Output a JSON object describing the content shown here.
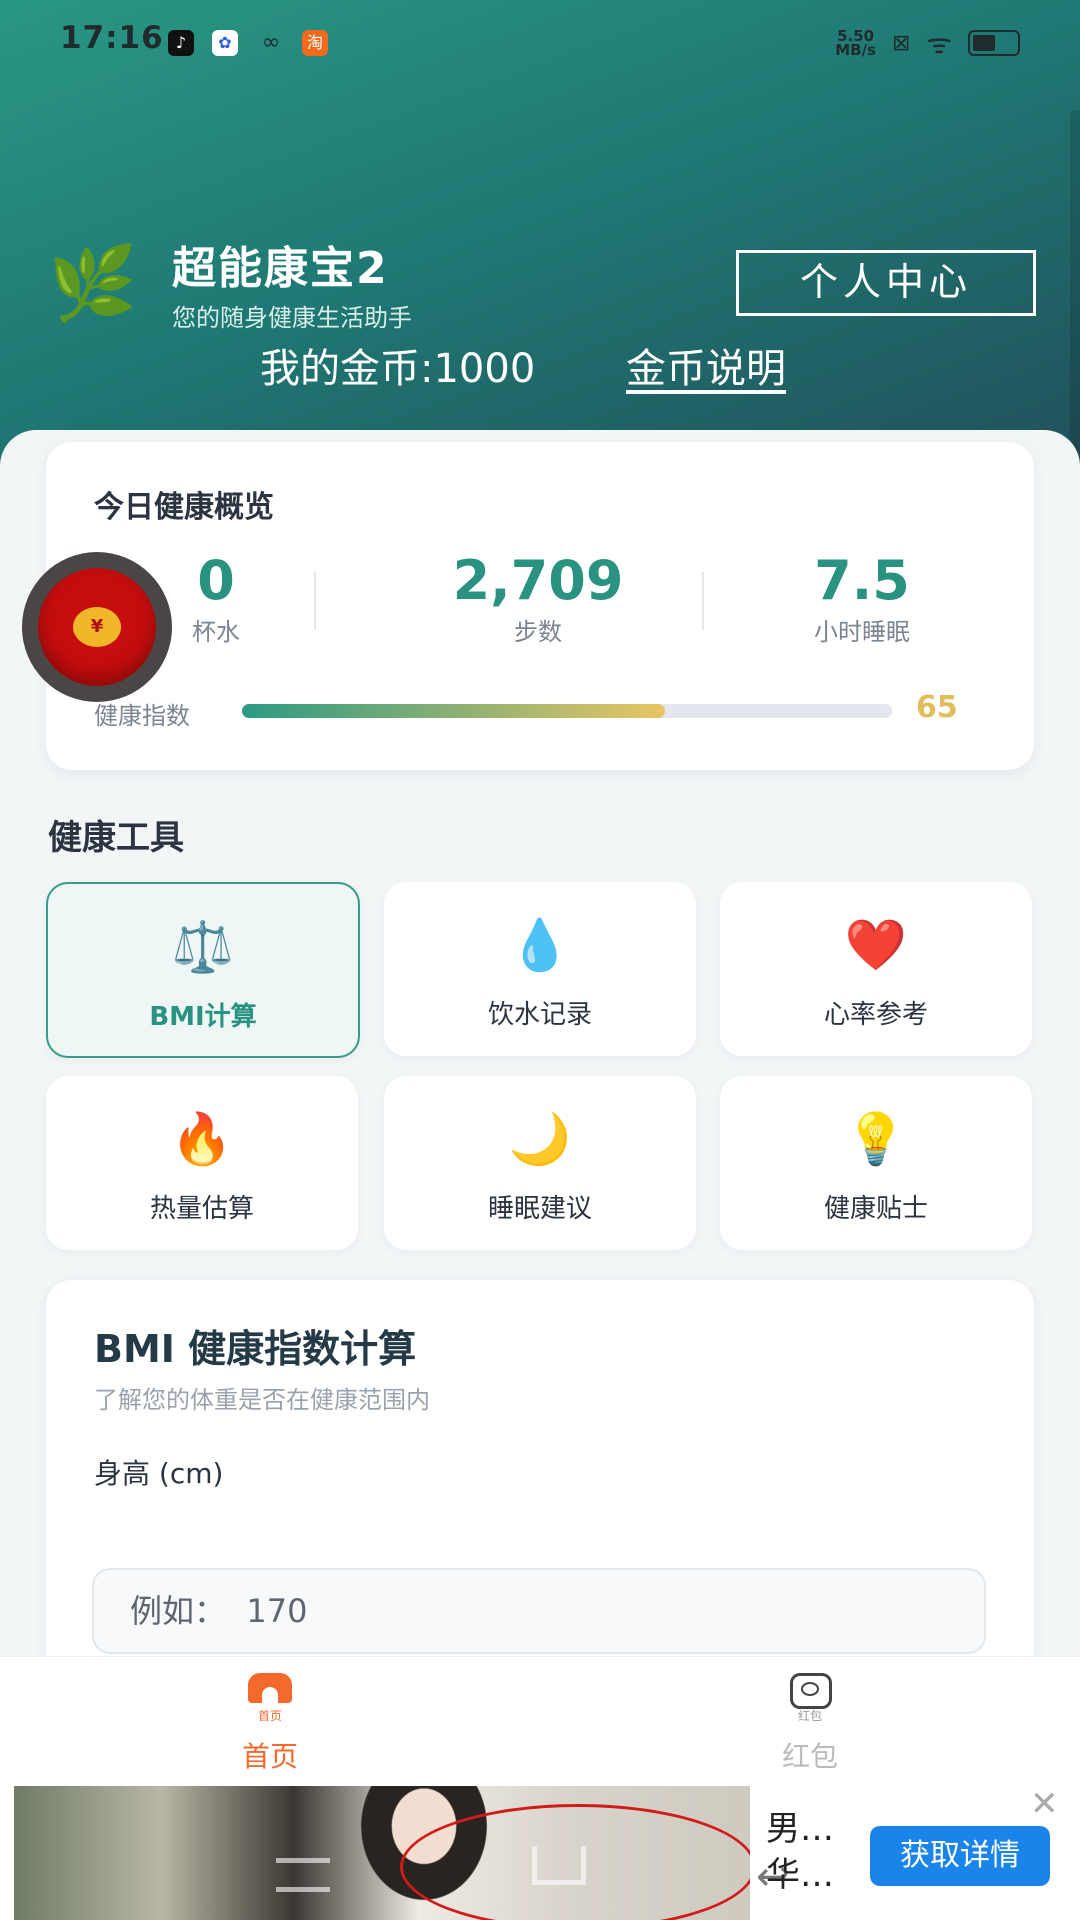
{
  "status_bar": {
    "time": "17:16",
    "net_speed_value": "5.50",
    "net_speed_unit": "MB/s",
    "apps": [
      "tiktok-icon",
      "baidu-icon",
      "link-icon",
      "taobao-icon"
    ]
  },
  "header": {
    "app_title": "超能康宝2",
    "app_subtitle": "您的随身健康生活助手",
    "profile_button": "个人中心",
    "coins_label": "我的金币:1000",
    "coins_link": "金币说明"
  },
  "overview": {
    "title": "今日健康概览",
    "stats": [
      {
        "value": "0",
        "label": "杯水"
      },
      {
        "value": "2,709",
        "label": "步数"
      },
      {
        "value": "7.5",
        "label": "小时睡眠"
      }
    ],
    "health_index_label": "健康指数",
    "health_index_value": "65",
    "health_index_fill": 0.65
  },
  "tools": {
    "title": "健康工具",
    "items": [
      {
        "icon": "⚖️",
        "label": "BMI计算"
      },
      {
        "icon": "💧",
        "label": "饮水记录"
      },
      {
        "icon": "❤️",
        "label": "心率参考"
      },
      {
        "icon": "🔥",
        "label": "热量估算"
      },
      {
        "icon": "🌙",
        "label": "睡眠建议"
      },
      {
        "icon": "💡",
        "label": "健康贴士"
      }
    ]
  },
  "bmi": {
    "title": "BMI 健康指数计算",
    "subtitle": "了解您的体重是否在健康范围内",
    "height_label": "身高 (cm)",
    "height_placeholder": "例如：  170"
  },
  "tabbar": {
    "home_mini": "首页",
    "home_label": "首页",
    "redpacket_mini": "红包",
    "redpacket_label": "红包"
  },
  "redpacket_float": {
    "coin_text": "¥"
  },
  "ad": {
    "text": "男…\n华…",
    "cta": "获取详情",
    "close": "✕"
  },
  "colors": {
    "accent": "#2a9280",
    "tab_active": "#f46a2c",
    "tab_inactive": "#bbbbbb",
    "gold": "#e2bd5c"
  }
}
